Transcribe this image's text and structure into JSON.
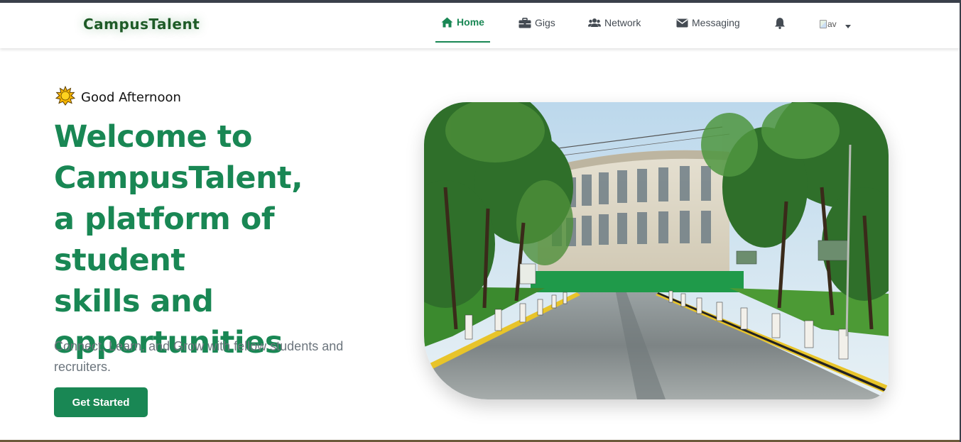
{
  "brand": "CampusTalent",
  "nav": {
    "home": "Home",
    "gigs": "Gigs",
    "network": "Network",
    "messaging": "Messaging",
    "notifications_icon": "bell-icon",
    "avatar_alt": "av"
  },
  "hero": {
    "greeting_icon": "sun-icon",
    "greeting": "Good Afternoon",
    "headline_line1": "Welcome to",
    "headline_line2": "CampusTalent,",
    "headline_line3": "a platform of student",
    "headline_line4": "skills and",
    "headline_line5": "opportunities",
    "subtitle": "Connect, Learn, and Grow with fellow students and recruiters.",
    "cta_label": "Get Started",
    "image_subject": "campus-building-photo"
  },
  "colors": {
    "brand_green": "#198754",
    "logo_green": "#1e5b27",
    "muted_text": "#6c757d",
    "nav_text": "#444b53"
  }
}
